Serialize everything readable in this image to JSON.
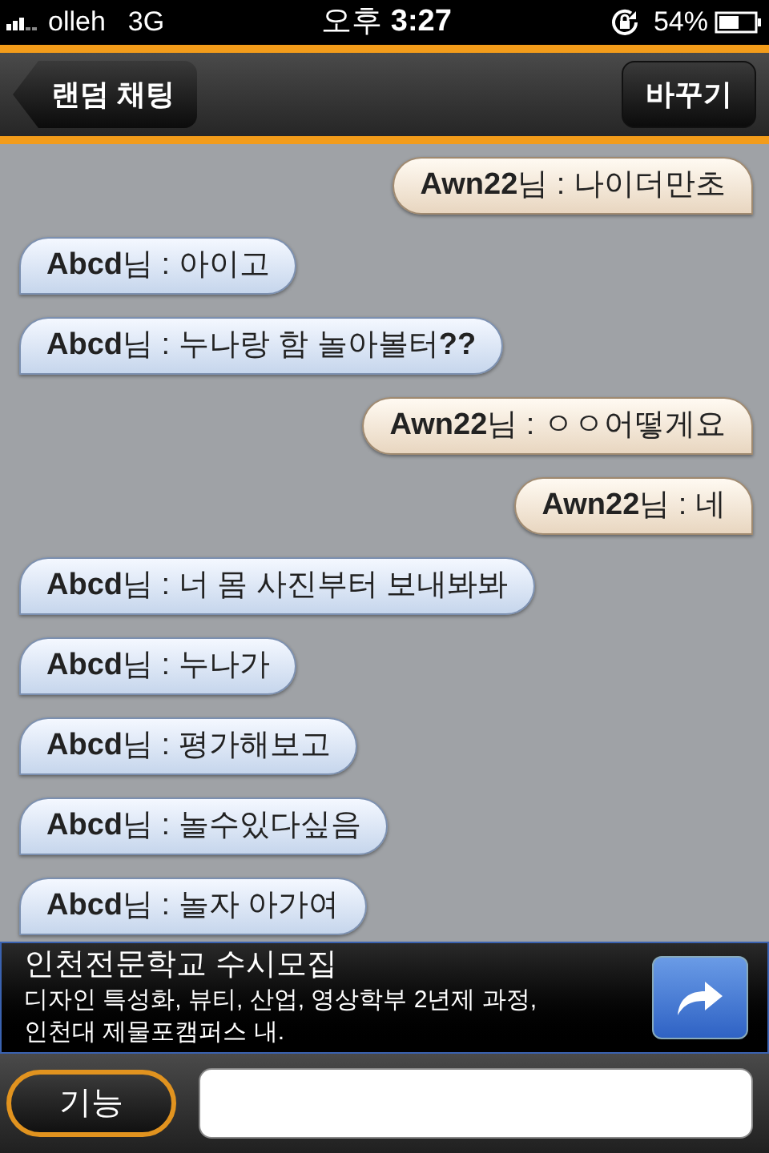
{
  "status_bar": {
    "carrier": "olleh",
    "network": "3G",
    "time": "오후 **3:27**",
    "battery": "54%"
  },
  "nav_bar": {
    "back_button": "랜덤 채팅",
    "right_button": "바꾸기"
  },
  "messages": [
    {
      "kind": "sent",
      "text": "**Awn22**님 : 나이더만초"
    },
    {
      "kind": "received",
      "text": "**Abcd**님 : 아이고"
    },
    {
      "kind": "received",
      "text": "**Abcd**님 : 누나랑 함 놀아볼터**??**"
    },
    {
      "kind": "sent",
      "text": "**Awn22**님 : ㅇㅇ어떻게요"
    },
    {
      "kind": "sent",
      "text": "**Awn22**님 : 네"
    },
    {
      "kind": "received",
      "text": "**Abcd**님 : 너 몸 사진부터 보내봐봐"
    },
    {
      "kind": "received",
      "text": "**Abcd**님 : 누나가"
    },
    {
      "kind": "received",
      "text": "**Abcd**님 : 평가해보고"
    },
    {
      "kind": "received",
      "text": "**Abcd**님 : 놀수있다싶음"
    },
    {
      "kind": "received",
      "text": "**Abcd**님 : 놀자 아가여"
    }
  ],
  "ad": {
    "title": "인천전문학교 수시모집",
    "lines": [
      "디자인 특성화, 뷰티, 산업, 영상학부 2년제 과정,",
      "인천대 제물포캠퍼스 내."
    ]
  },
  "bottom_bar": {
    "function_button": "기능"
  }
}
